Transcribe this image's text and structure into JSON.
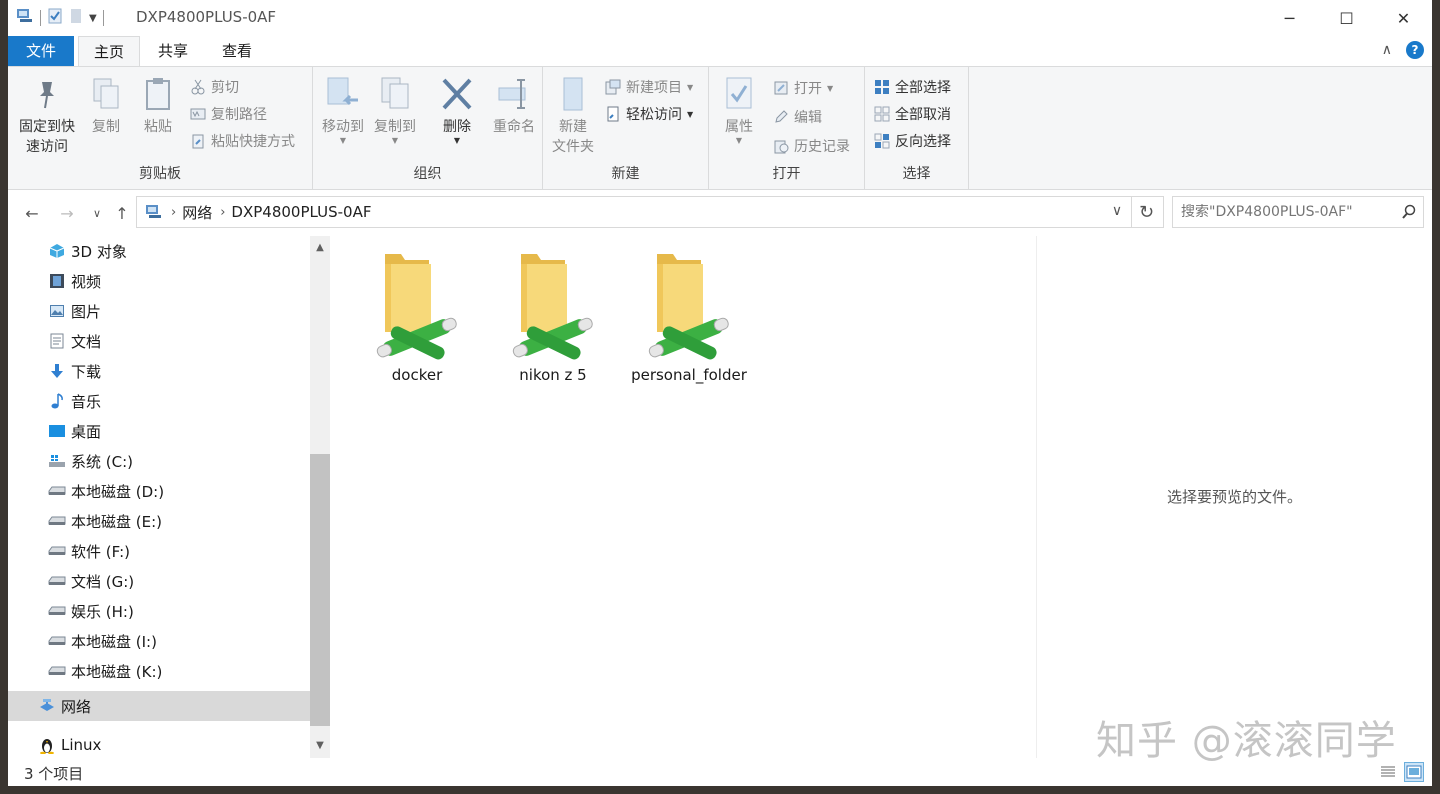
{
  "window": {
    "title": "DXP4800PLUS-0AF",
    "controls": {
      "minimize": "─",
      "maximize": "☐",
      "close": "✕"
    }
  },
  "tabs": {
    "file": "文件",
    "home": "主页",
    "share": "共享",
    "view": "查看",
    "help": "?"
  },
  "ribbon": {
    "clipboard": {
      "label": "剪贴板",
      "pin": "固定到快速访问",
      "pin_line1": "固定到快",
      "pin_line2": "速访问",
      "copy": "复制",
      "paste": "粘贴",
      "cut": "剪切",
      "copy_path": "复制路径",
      "paste_shortcut": "粘贴快捷方式"
    },
    "organize": {
      "label": "组织",
      "move_to": "移动到",
      "copy_to": "复制到",
      "delete": "删除",
      "rename": "重命名"
    },
    "new": {
      "label": "新建",
      "new_folder_line1": "新建",
      "new_folder_line2": "文件夹",
      "new_item": "新建项目",
      "easy_access": "轻松访问"
    },
    "open": {
      "label": "打开",
      "properties": "属性",
      "open": "打开",
      "edit": "编辑",
      "history": "历史记录"
    },
    "select": {
      "label": "选择",
      "select_all": "全部选择",
      "select_none": "全部取消",
      "invert": "反向选择"
    }
  },
  "address": {
    "crumbs": [
      "网络",
      "DXP4800PLUS-0AF"
    ],
    "search_placeholder": "搜索\"DXP4800PLUS-0AF\""
  },
  "nav_pane": {
    "items": [
      {
        "label": "3D 对象",
        "icon": "3d-objects-icon"
      },
      {
        "label": "视频",
        "icon": "videos-icon"
      },
      {
        "label": "图片",
        "icon": "pictures-icon"
      },
      {
        "label": "文档",
        "icon": "documents-icon"
      },
      {
        "label": "下载",
        "icon": "downloads-icon"
      },
      {
        "label": "音乐",
        "icon": "music-icon"
      },
      {
        "label": "桌面",
        "icon": "desktop-icon"
      },
      {
        "label": "系统 (C:)",
        "icon": "system-drive-icon"
      },
      {
        "label": "本地磁盘 (D:)",
        "icon": "drive-icon"
      },
      {
        "label": "本地磁盘 (E:)",
        "icon": "drive-icon"
      },
      {
        "label": "软件 (F:)",
        "icon": "drive-icon"
      },
      {
        "label": "文档 (G:)",
        "icon": "drive-icon"
      },
      {
        "label": "娱乐 (H:)",
        "icon": "drive-icon"
      },
      {
        "label": "本地磁盘 (I:)",
        "icon": "drive-icon"
      },
      {
        "label": "本地磁盘 (K:)",
        "icon": "drive-icon"
      }
    ],
    "network": "网络",
    "linux": "Linux"
  },
  "content": {
    "folders": [
      {
        "name": "docker"
      },
      {
        "name": "nikon z 5"
      },
      {
        "name": "personal_folder"
      }
    ]
  },
  "preview": {
    "empty_text": "选择要预览的文件。"
  },
  "status": {
    "count": "3 个项目"
  },
  "watermark": "知乎 @滚滚同学",
  "colors": {
    "accent": "#1979ca",
    "folder": "#f2cf6b",
    "share_pipe": "#3cb043"
  }
}
